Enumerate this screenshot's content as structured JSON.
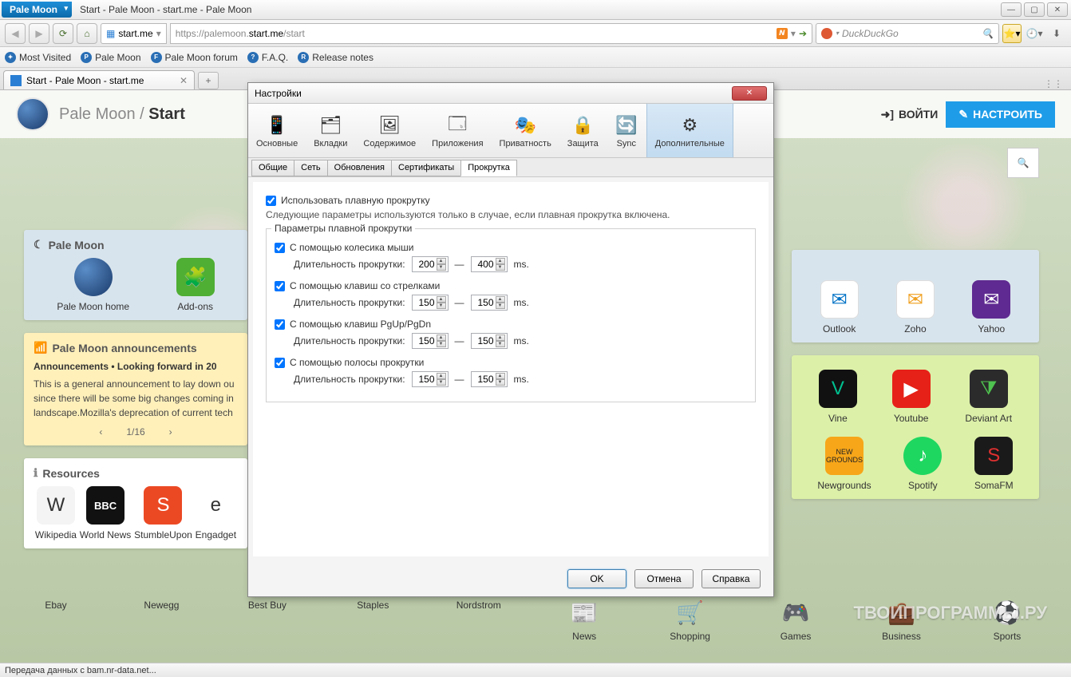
{
  "window": {
    "app_name": "Pale Moon",
    "title": "Start - Pale Moon - start.me - Pale Moon"
  },
  "nav": {
    "identity_text": "start.me",
    "url_prefix": "https://palemoon.",
    "url_highlight": "start.me",
    "url_suffix": "/start",
    "search_placeholder": "DuckDuckGo"
  },
  "bookmarks": [
    {
      "icon": "✦",
      "label": "Most Visited"
    },
    {
      "icon": "P",
      "label": "Pale Moon"
    },
    {
      "icon": "F",
      "label": "Pale Moon forum"
    },
    {
      "icon": "?",
      "label": "F.A.Q."
    },
    {
      "icon": "R",
      "label": "Release notes"
    }
  ],
  "tab": {
    "title": "Start - Pale Moon - start.me"
  },
  "page": {
    "brand": "Pale Moon",
    "brand_suffix": "Start",
    "login": "ВОЙТИ",
    "setup": "НАСТРОИТЬ",
    "pm_widget_title": "Pale Moon",
    "pm_tiles": [
      {
        "label": "Pale Moon home",
        "bg": "radial-gradient(circle at 30% 30%, #5a8dc8, #1a3a6a)"
      },
      {
        "label": "Add-ons",
        "bg": "#4fae34"
      }
    ],
    "announce_title": "Pale Moon announcements",
    "announce_head": "Announcements • Looking forward in 20",
    "announce_body": "This is a general announcement to lay down ou since there will be some big changes coming in landscape.Mozilla's deprecation of current tech",
    "pager": "1/16",
    "resources_title": "Resources",
    "resources": [
      {
        "label": "Wikipedia",
        "bg": "#f4f4f4",
        "fg": "#333",
        "txt": "W"
      },
      {
        "label": "World News",
        "bg": "#111",
        "fg": "#fff",
        "txt": "BBC"
      },
      {
        "label": "StumbleUpon",
        "bg": "#eb4924",
        "fg": "#fff",
        "txt": "S"
      },
      {
        "label": "Engadget",
        "bg": "#fff",
        "fg": "#333",
        "txt": "e"
      }
    ],
    "mail_tiles": [
      {
        "label": "Outlook",
        "bg": "#0072c6"
      },
      {
        "label": "Zoho",
        "bg": "#f0a020"
      },
      {
        "label": "Yahoo",
        "bg": "#5f2a91"
      }
    ],
    "media_tiles_1": [
      {
        "label": "Vine",
        "bg": "#00bf8f",
        "txt": "V"
      },
      {
        "label": "Youtube",
        "bg": "#e62117",
        "txt": "▶"
      },
      {
        "label": "Deviant Art",
        "bg": "#2b2b2b",
        "txt": "⧩"
      }
    ],
    "media_tiles_2": [
      {
        "label": "Newgrounds",
        "bg": "#f7a619",
        "txt": "N"
      },
      {
        "label": "Spotify",
        "bg": "#1ed760",
        "txt": "♫"
      },
      {
        "label": "SomaFM",
        "bg": "#1a1a1a",
        "txt": "S"
      }
    ],
    "bottom": [
      {
        "label": "Ebay"
      },
      {
        "label": "Newegg"
      },
      {
        "label": "Best Buy"
      },
      {
        "label": "Staples"
      },
      {
        "label": "Nordstrom"
      },
      {
        "label": "News"
      },
      {
        "label": "Shopping"
      },
      {
        "label": "Games"
      },
      {
        "label": "Business"
      },
      {
        "label": "Sports"
      }
    ]
  },
  "dialog": {
    "title": "Настройки",
    "categories": [
      {
        "label": "Основные",
        "icon": "▭"
      },
      {
        "label": "Вкладки",
        "icon": "🗂"
      },
      {
        "label": "Содержимое",
        "icon": "🖼"
      },
      {
        "label": "Приложения",
        "icon": "🗔"
      },
      {
        "label": "Приватность",
        "icon": "🎭"
      },
      {
        "label": "Защита",
        "icon": "🔒"
      },
      {
        "label": "Sync",
        "icon": "🔄"
      },
      {
        "label": "Дополнительные",
        "icon": "⚙"
      }
    ],
    "tabs": [
      "Общие",
      "Сеть",
      "Обновления",
      "Сертификаты",
      "Прокрутка"
    ],
    "active_tab": 4,
    "smooth_label": "Использовать плавную прокрутку",
    "note": "Следующие параметры используются только в случае, если плавная прокрутка включена.",
    "group_label": "Параметры плавной прокрутки",
    "duration_label": "Длительность прокрутки:",
    "dash": "—",
    "unit": "ms.",
    "rows": [
      {
        "label": "С помощью колесика мыши",
        "a": "200",
        "b": "400"
      },
      {
        "label": "С помощью клавиш со стрелками",
        "a": "150",
        "b": "150"
      },
      {
        "label": "С помощью клавиш PgUp/PgDn",
        "a": "150",
        "b": "150"
      },
      {
        "label": "С помощью полосы прокрутки",
        "a": "150",
        "b": "150"
      }
    ],
    "ok": "OK",
    "cancel": "Отмена",
    "help": "Справка"
  },
  "status": "Передача данных с bam.nr-data.net...",
  "watermark": "ТВОИПРОГРАММЫ.РУ"
}
